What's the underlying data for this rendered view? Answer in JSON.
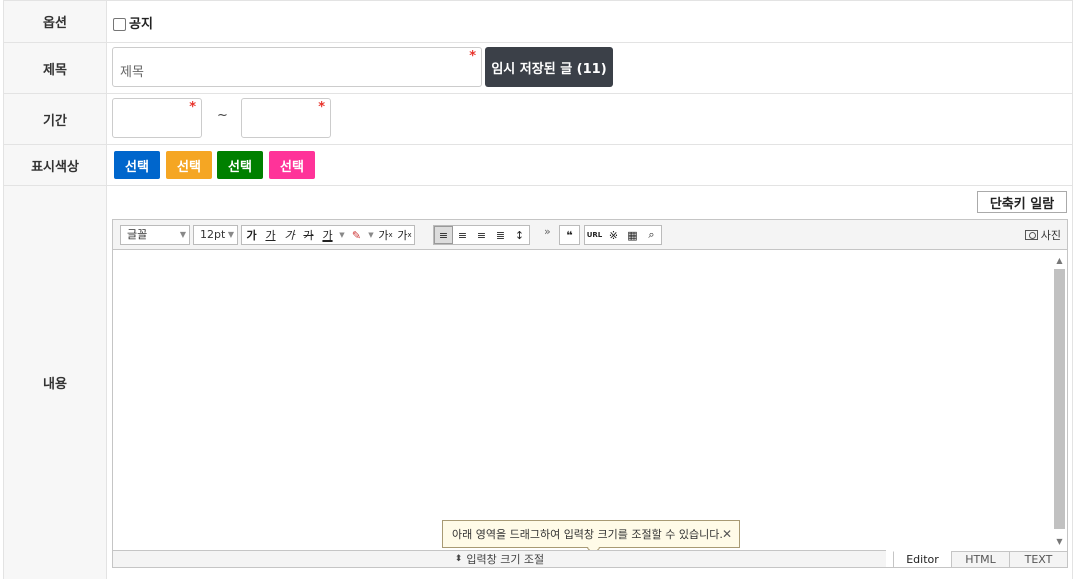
{
  "labels": {
    "option": "옵션",
    "title": "제목",
    "period": "기간",
    "color": "표시색상",
    "content": "내용"
  },
  "option": {
    "notice_label": "공지",
    "notice_checked": false
  },
  "title_field": {
    "placeholder": "제목",
    "required_mark": "*"
  },
  "draft_button": "임시 저장된 글 (11)",
  "period": {
    "required_mark": "*",
    "separator": "~"
  },
  "color_buttons": [
    {
      "label": "선택",
      "color": "#0066cc"
    },
    {
      "label": "선택",
      "color": "#f5a623"
    },
    {
      "label": "선택",
      "color": "#008000"
    },
    {
      "label": "선택",
      "color": "#ff3399"
    }
  ],
  "editor": {
    "shortcut_button": "단축키 일람",
    "font_select": "글꼴",
    "size_select": "12pt",
    "format_buttons": [
      "가",
      "가",
      "가",
      "가",
      "가"
    ],
    "super_label": "가",
    "sub_label": "가",
    "more": "»",
    "url_label": "URL",
    "photo_label": "사진",
    "tooltip": "아래 영역을 드래그하여 입력창 크기를 조절할 수 있습니다.",
    "tooltip_close": "✕",
    "resize_label": "입력창 크기 조절",
    "modes": [
      "Editor",
      "HTML",
      "TEXT"
    ]
  }
}
